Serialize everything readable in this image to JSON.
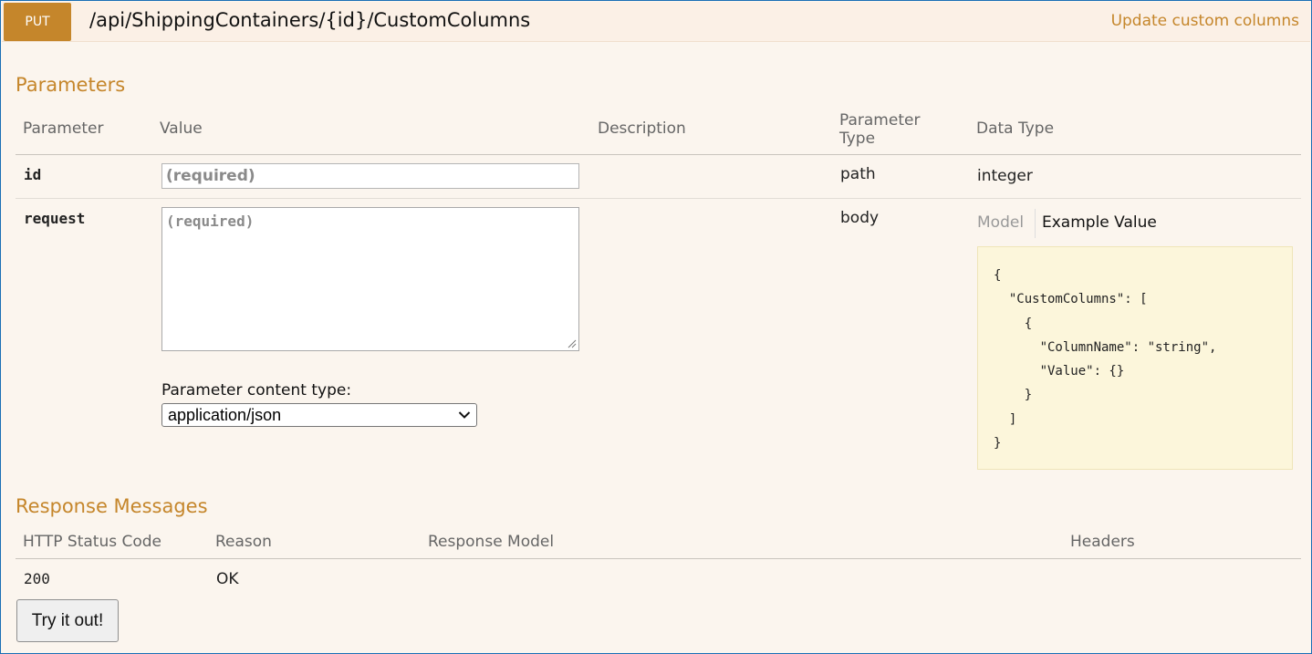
{
  "operation": {
    "method": "PUT",
    "path": "/api/ShippingContainers/{id}/CustomColumns",
    "summary": "Update custom columns"
  },
  "parameters": {
    "title": "Parameters",
    "headers": {
      "parameter": "Parameter",
      "value": "Value",
      "description": "Description",
      "parameter_type_line1": "Parameter",
      "parameter_type_line2": "Type",
      "data_type": "Data Type"
    },
    "rows": [
      {
        "name": "id",
        "placeholder": "(required)",
        "param_type": "path",
        "data_type": "integer"
      },
      {
        "name": "request",
        "placeholder": "(required)",
        "param_type": "body"
      }
    ],
    "content_type_label": "Parameter content type:",
    "content_type_selected": "application/json",
    "tabs": {
      "model": "Model",
      "example": "Example Value"
    },
    "example_value": "{\n  \"CustomColumns\": [\n    {\n      \"ColumnName\": \"string\",\n      \"Value\": {}\n    }\n  ]\n}"
  },
  "responses": {
    "title": "Response Messages",
    "headers": {
      "status": "HTTP Status Code",
      "reason": "Reason",
      "model": "Response Model",
      "headers": "Headers"
    },
    "rows": [
      {
        "status": "200",
        "reason": "OK"
      }
    ]
  },
  "try_button": "Try it out!",
  "colors": {
    "accent": "#c5862b",
    "background": "#fbf5ee",
    "example_background": "#fcf6db"
  }
}
